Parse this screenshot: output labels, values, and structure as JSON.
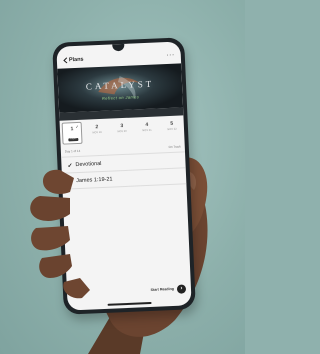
{
  "colors": {
    "background": "#8fb1ad",
    "phone_frame": "#1e2327",
    "screen": "#f4f4f4",
    "accent_green": "#9bd38c",
    "text": "#222222"
  },
  "header": {
    "back_label": "Plans",
    "more_icon": "ellipsis-icon"
  },
  "banner": {
    "title": "CATALYST",
    "subtitle": "Reflect on James"
  },
  "days": [
    {
      "num": "1",
      "date": "",
      "tag": "TODAY",
      "selected": true,
      "completed": true
    },
    {
      "num": "2",
      "date": "NOV 19",
      "tag": "",
      "selected": false,
      "completed": false
    },
    {
      "num": "3",
      "date": "NOV 20",
      "tag": "",
      "selected": false,
      "completed": false
    },
    {
      "num": "4",
      "date": "NOV 21",
      "tag": "",
      "selected": false,
      "completed": false
    },
    {
      "num": "5",
      "date": "NOV 22",
      "tag": "",
      "selected": false,
      "completed": false
    }
  ],
  "meta": {
    "left": "Day 1 of 14",
    "right": "On Track"
  },
  "items": [
    {
      "label": "Devotional",
      "checked": true
    },
    {
      "label": "James 1:19-21",
      "checked": true
    }
  ],
  "footer": {
    "label": "Start Reading"
  }
}
